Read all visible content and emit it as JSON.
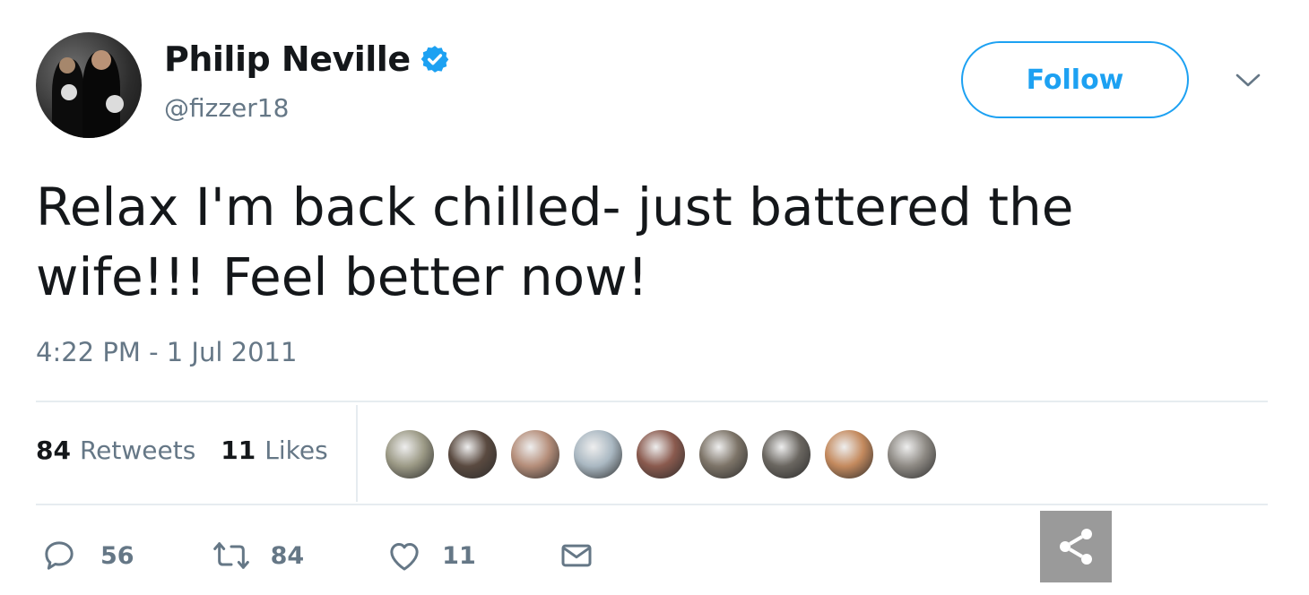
{
  "author": {
    "name": "Philip Neville",
    "handle": "@fizzer18",
    "verified_icon": "verified-badge-icon",
    "verified_color": "#1da1f2"
  },
  "header": {
    "follow_label": "Follow",
    "menu_icon": "chevron-down-icon"
  },
  "tweet": {
    "text": "Relax I'm back chilled- just battered the wife!!! Feel better now!",
    "timestamp": "4:22 PM - 1 Jul 2011"
  },
  "stats": {
    "retweets_count": "84",
    "retweets_label": "Retweets",
    "likes_count": "11",
    "likes_label": "Likes"
  },
  "likers": [
    {
      "name": "liker-avatar-1",
      "color": "#9c9a86"
    },
    {
      "name": "liker-avatar-2",
      "color": "#5a4a40"
    },
    {
      "name": "liker-avatar-3",
      "color": "#b58e7a"
    },
    {
      "name": "liker-avatar-4",
      "color": "#aab8c2"
    },
    {
      "name": "liker-avatar-5",
      "color": "#8a5a4e"
    },
    {
      "name": "liker-avatar-6",
      "color": "#7d7468"
    },
    {
      "name": "liker-avatar-7",
      "color": "#6a6660"
    },
    {
      "name": "liker-avatar-8",
      "color": "#c48a5e"
    },
    {
      "name": "liker-avatar-9",
      "color": "#8e8a84"
    }
  ],
  "actions": {
    "reply_count": "56",
    "retweet_count": "84",
    "like_count": "11",
    "reply_icon": "reply-icon",
    "retweet_icon": "retweet-icon",
    "like_icon": "heart-icon",
    "dm_icon": "envelope-icon",
    "share_icon": "share-icon"
  },
  "colors": {
    "accent": "#1da1f2",
    "text": "#14171a",
    "muted": "#657786",
    "divider": "#e6ecf0",
    "share_bg": "#9a9a9a"
  }
}
